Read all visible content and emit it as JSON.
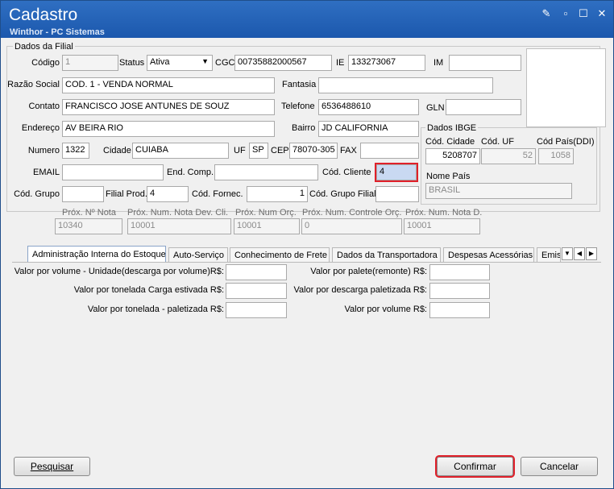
{
  "window": {
    "title": "Cadastro",
    "subtitle": "Winthor - PC Sistemas"
  },
  "dados_filial": {
    "group_label": "Dados da Filial",
    "codigo": {
      "label": "Código",
      "value": "1"
    },
    "status": {
      "label": "Status",
      "value": "Ativa"
    },
    "cgc": {
      "label": "CGC",
      "value": "00735882000567"
    },
    "ie": {
      "label": "IE",
      "value": "133273067"
    },
    "im": {
      "label": "IM",
      "value": ""
    },
    "razao_social": {
      "label": "Razão Social",
      "value": "COD. 1 - VENDA NORMAL"
    },
    "fantasia": {
      "label": "Fantasia",
      "value": ""
    },
    "contato": {
      "label": "Contato",
      "value": "FRANCISCO JOSE ANTUNES DE SOUZ"
    },
    "telefone": {
      "label": "Telefone",
      "value": "6536488610"
    },
    "gln": {
      "label": "GLN",
      "value": ""
    },
    "endereco": {
      "label": "Endereço",
      "value": "AV BEIRA RIO"
    },
    "bairro": {
      "label": "Bairro",
      "value": "JD CALIFORNIA"
    },
    "numero": {
      "label": "Numero",
      "value": "1322"
    },
    "cidade": {
      "label": "Cidade",
      "value": "CUIABA"
    },
    "uf": {
      "label": "UF",
      "value": "SP"
    },
    "cep": {
      "label": "CEP",
      "value": "78070-305"
    },
    "fax": {
      "label": "FAX",
      "value": ""
    },
    "email": {
      "label": "EMAIL",
      "value": ""
    },
    "end_comp": {
      "label": "End. Comp.",
      "value": ""
    },
    "cod_cliente": {
      "label": "Cód. Cliente",
      "value": "4"
    },
    "cod_grupo": {
      "label": "Cód. Grupo",
      "value": ""
    },
    "filial_prod": {
      "label": "Filial Prod.",
      "value": "4"
    },
    "cod_fornec": {
      "label": "Cód. Fornec.",
      "value": "1"
    },
    "cod_grupo_filial": {
      "label": "Cód. Grupo Filial",
      "value": ""
    },
    "prox_nota": {
      "label": "Próx. Nº Nota",
      "value": "10340"
    },
    "prox_nota_dev": {
      "label": "Próx. Num. Nota Dev. Cli.",
      "value": "10001"
    },
    "prox_orc": {
      "label": "Próx. Num Orç.",
      "value": "10001"
    },
    "prox_controle_orc": {
      "label": "Próx. Num. Controle Orç.",
      "value": "0"
    },
    "prox_nota_d": {
      "label": "Próx. Num. Nota D.",
      "value": "10001"
    }
  },
  "dados_ibge": {
    "group_label": "Dados IBGE",
    "cod_cidade": {
      "label": "Cód. Cidade",
      "value": "5208707"
    },
    "cod_uf": {
      "label": "Cód. UF",
      "value": "52"
    },
    "cod_pais": {
      "label": "Cód País(DDI)",
      "value": "1058"
    },
    "nome_pais": {
      "label": "Nome País",
      "value": "BRASIL"
    }
  },
  "tabs": [
    "Administração Interna do Estoque",
    "Auto-Serviço",
    "Conhecimento de Frete",
    "Dados da Transportadora",
    "Despesas Acessórias",
    "Emiss"
  ],
  "estoque": {
    "valor_volume_unidade": {
      "label": "Valor por volume - Unidade(descarga por volume)R$:",
      "value": ""
    },
    "valor_tonelada_estivada": {
      "label": "Valor por tonelada Carga estivada R$:",
      "value": ""
    },
    "valor_tonelada_paletizada": {
      "label": "Valor por tonelada - paletizada R$:",
      "value": ""
    },
    "valor_palete": {
      "label": "Valor por palete(remonte) R$:",
      "value": ""
    },
    "valor_descarga_paletizada": {
      "label": "Valor por descarga paletizada R$:",
      "value": ""
    },
    "valor_volume": {
      "label": "Valor por volume R$:",
      "value": ""
    }
  },
  "buttons": {
    "pesquisar": "Pesquisar",
    "confirmar": "Confirmar",
    "cancelar": "Cancelar"
  },
  "colors": {
    "titlebar": "#1c58ad",
    "highlight": "#e0202a"
  }
}
